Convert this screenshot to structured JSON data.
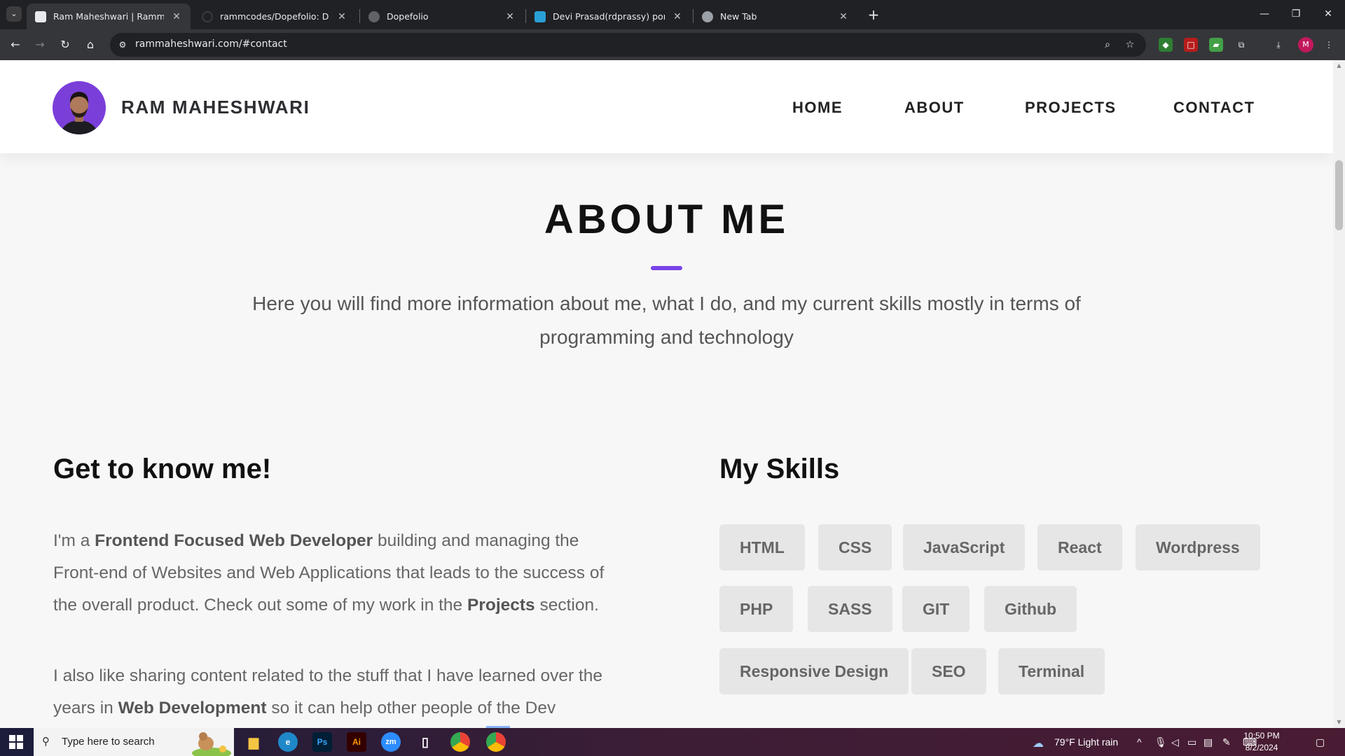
{
  "browser": {
    "tabs": [
      {
        "title": "Ram Maheshwari | RammCodes",
        "active": true
      },
      {
        "title": "rammcodes/Dopefolio: Dopefolio",
        "active": false
      },
      {
        "title": "Dopefolio",
        "active": false
      },
      {
        "title": "Devi Prasad(rdprassy) portfolio",
        "active": false
      },
      {
        "title": "New Tab",
        "active": false
      }
    ],
    "url": "rammaheshwari.com/#contact",
    "profile_initial": "M"
  },
  "site": {
    "brand": "RAM MAHESHWARI",
    "nav": [
      "HOME",
      "ABOUT",
      "PROJECTS",
      "CONTACT"
    ],
    "about_title": "ABOUT ME",
    "about_subtitle": "Here you will find more information about me, what I do, and my current skills mostly in terms of programming and technology",
    "intro_heading": "Get to know me!",
    "intro_p1": {
      "a": "I'm a ",
      "b": "Frontend Focused Web Developer",
      "c": " building and managing the Front-end of Websites and Web Applications that leads to the success of the overall product. Check out some of my work in the ",
      "d": "Projects",
      "e": " section."
    },
    "intro_p2": {
      "a": "I also like sharing content related to the stuff that I have learned over the years in ",
      "b": "Web Development",
      "c": " so it can help other people of the Dev"
    },
    "skills_heading": "My Skills",
    "skills": [
      "HTML",
      "CSS",
      "JavaScript",
      "React",
      "Wordpress",
      "PHP",
      "SASS",
      "GIT",
      "Github",
      "Responsive Design",
      "SEO",
      "Terminal"
    ]
  },
  "taskbar": {
    "search_placeholder": "Type here to search",
    "weather": "79°F  Light rain",
    "time": "10:50 PM",
    "date": "8/2/2024"
  }
}
